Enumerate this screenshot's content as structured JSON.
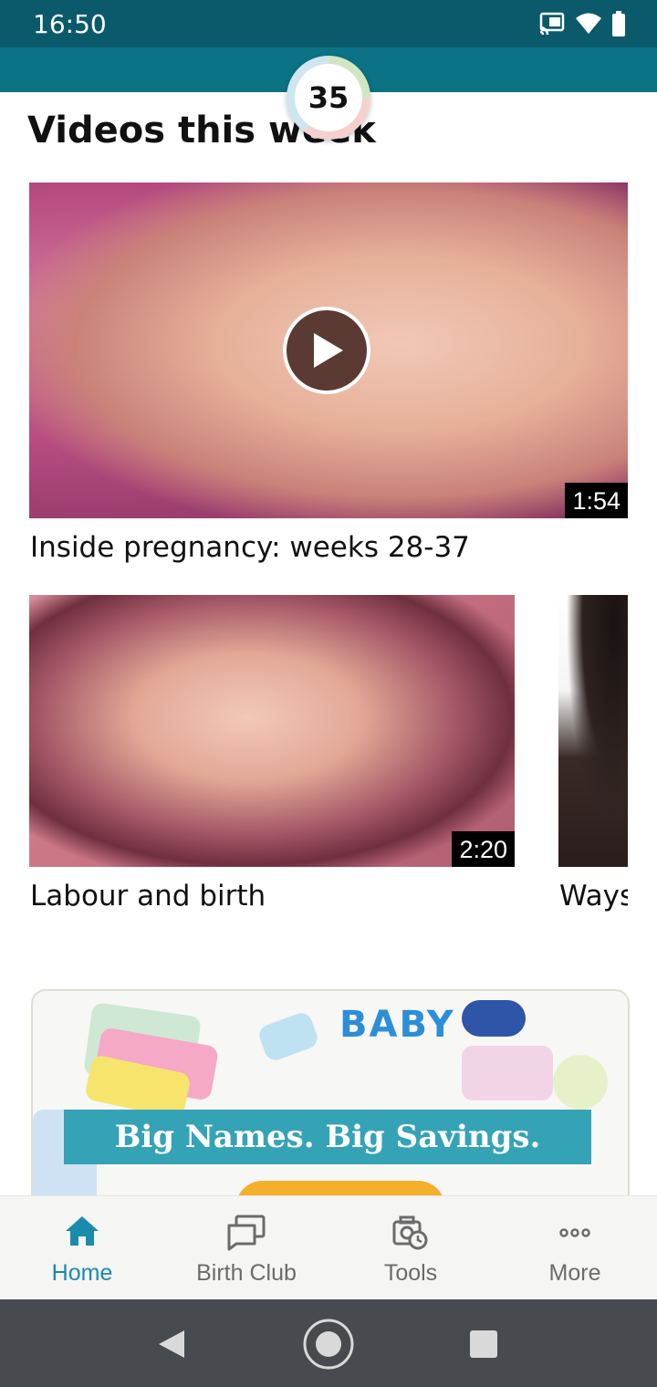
{
  "status_bar": {
    "time": "16:50"
  },
  "week_badge": {
    "number": "35"
  },
  "section": {
    "title": "Videos this week"
  },
  "videos": [
    {
      "title": "Inside pregnancy: weeks 28-37",
      "duration": "1:54"
    },
    {
      "title": "Labour and birth",
      "duration": "2:20"
    },
    {
      "title": "Ways"
    }
  ],
  "ad": {
    "headline": "Big Names. Big Savings.",
    "image_text": "BABY"
  },
  "bottom_nav": {
    "items": [
      {
        "label": "Home",
        "icon": "home-icon",
        "active": true
      },
      {
        "label": "Birth Club",
        "icon": "chat-bubbles-icon",
        "active": false
      },
      {
        "label": "Tools",
        "icon": "tools-icon",
        "active": false
      },
      {
        "label": "More",
        "icon": "more-dots-icon",
        "active": false
      }
    ]
  },
  "colors": {
    "status_bar": "#0a5a6c",
    "app_bar": "#0b7385",
    "accent": "#1a8cab",
    "ad_banner": "#35a3b6",
    "ad_button": "#f4b02a",
    "system_nav": "#474a4f"
  }
}
